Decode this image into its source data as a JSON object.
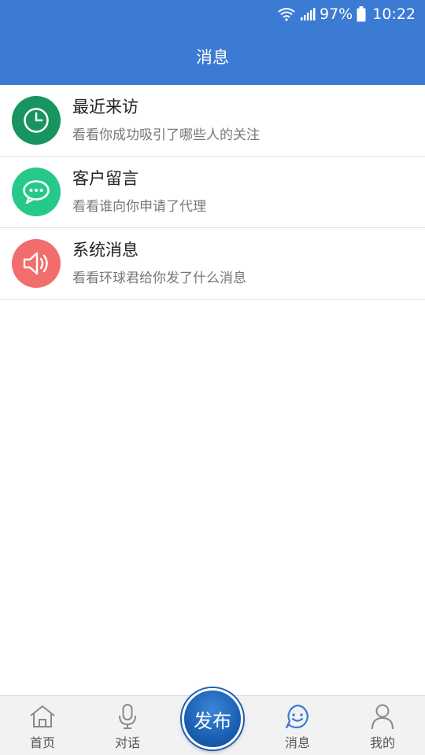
{
  "status_bar": {
    "battery": "97%",
    "time": "10:22",
    "icons": [
      "wifi-icon",
      "signal-icon",
      "battery-icon"
    ]
  },
  "header": {
    "title": "消息"
  },
  "list": [
    {
      "title": "最近来访",
      "subtitle": "看看你成功吸引了哪些人的关注",
      "icon": "clock-icon",
      "color": "#17945f"
    },
    {
      "title": "客户留言",
      "subtitle": "看看谁向你申请了代理",
      "icon": "chat-bubble-icon",
      "color": "#27c98a"
    },
    {
      "title": "系统消息",
      "subtitle": "看看环球君给你发了什么消息",
      "icon": "speaker-icon",
      "color": "#f26d6d"
    }
  ],
  "tabs": [
    {
      "label": "首页",
      "icon": "home-icon",
      "active": false
    },
    {
      "label": "对话",
      "icon": "microphone-icon",
      "active": false
    },
    {
      "label": "发布",
      "icon": "publish-button",
      "active": false
    },
    {
      "label": "消息",
      "icon": "smile-chat-icon",
      "active": true
    },
    {
      "label": "我的",
      "icon": "person-icon",
      "active": false
    }
  ],
  "colors": {
    "primary": "#3c7bd4",
    "tab_bar_bg": "#f2f2f2",
    "publish_button": "#1b5fb3"
  }
}
